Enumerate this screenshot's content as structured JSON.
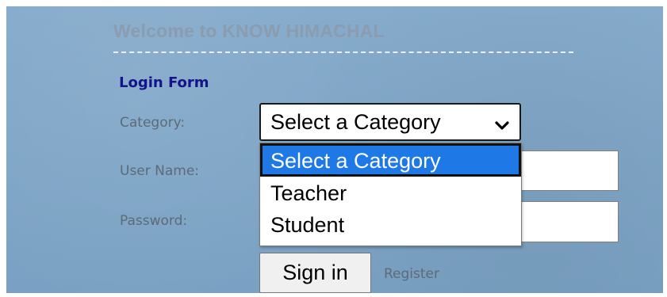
{
  "header": {
    "welcome": "Welcome to KNOW HIMACHAL"
  },
  "form": {
    "title": "Login Form",
    "category_label": "Category:",
    "category_selected": "Select a Category",
    "username_label": "User Name:",
    "password_label": "Password:",
    "username_value": "",
    "password_value": "",
    "category_options": [
      "Select a Category",
      "Teacher",
      "Student"
    ],
    "signin_label": "Sign in",
    "register_label": "Register"
  },
  "colors": {
    "panel_background": "#7fa5c6",
    "form_title": "#14148a",
    "highlight": "#1e78e6"
  },
  "icons": {
    "select_arrow": "chevron-down-icon"
  }
}
